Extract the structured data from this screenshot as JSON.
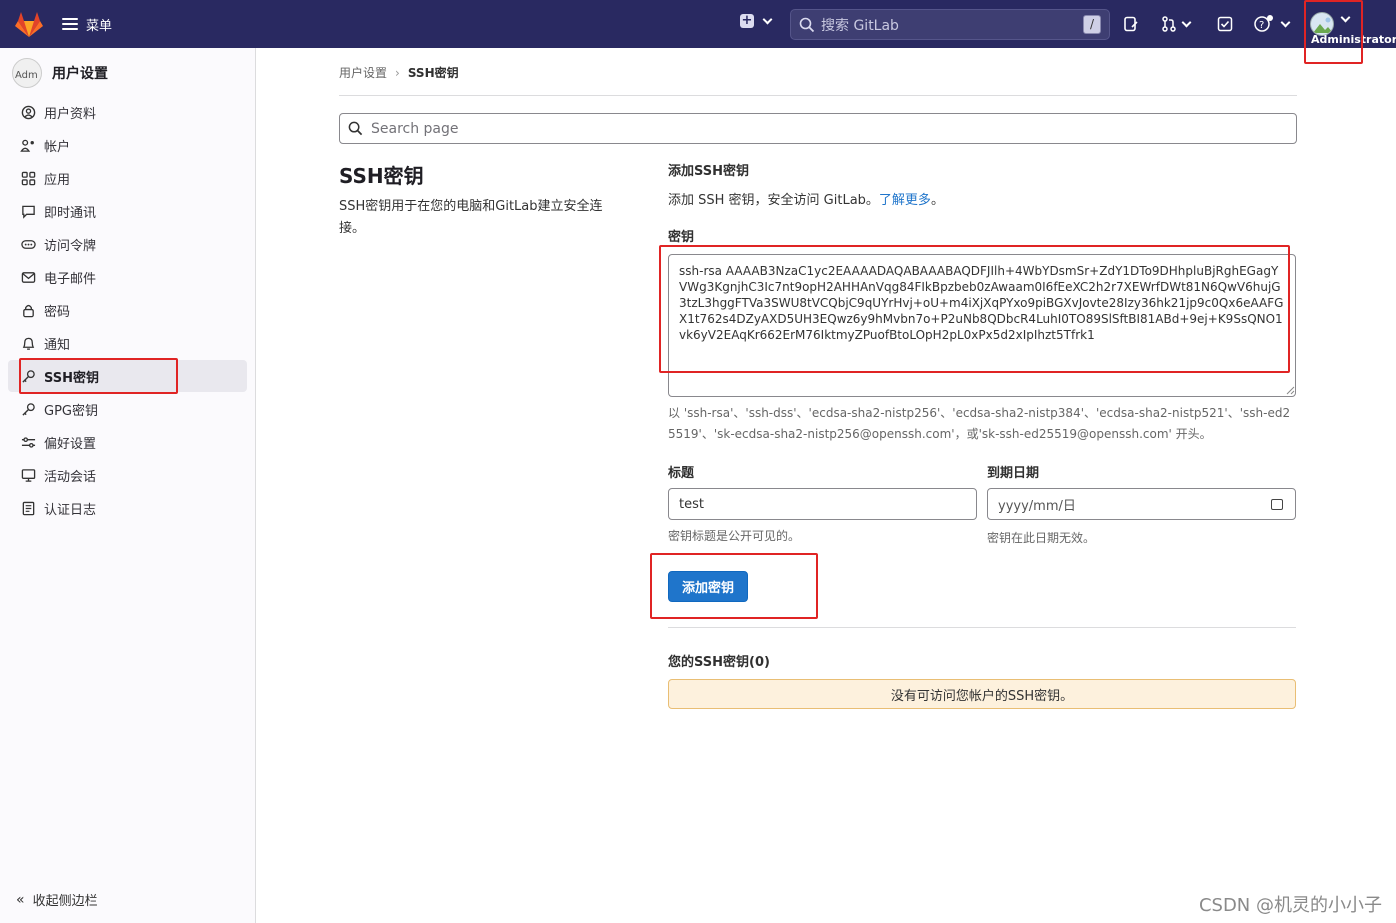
{
  "topbar": {
    "menu_label": "菜单",
    "search_placeholder": "搜索 GitLab",
    "search_shortcut": "/",
    "user_name": "Administrator"
  },
  "sidebar": {
    "title": "用户设置",
    "avatar_alt": "Adm",
    "items": [
      {
        "label": "用户资料",
        "icon": "profile-icon"
      },
      {
        "label": "帐户",
        "icon": "account-icon"
      },
      {
        "label": "应用",
        "icon": "applications-icon"
      },
      {
        "label": "即时通讯",
        "icon": "chat-icon"
      },
      {
        "label": "访问令牌",
        "icon": "token-icon"
      },
      {
        "label": "电子邮件",
        "icon": "mail-icon"
      },
      {
        "label": "密码",
        "icon": "lock-icon"
      },
      {
        "label": "通知",
        "icon": "bell-icon"
      },
      {
        "label": "SSH密钥",
        "icon": "key-icon"
      },
      {
        "label": "GPG密钥",
        "icon": "key-icon"
      },
      {
        "label": "偏好设置",
        "icon": "preferences-icon"
      },
      {
        "label": "活动会话",
        "icon": "sessions-icon"
      },
      {
        "label": "认证日志",
        "icon": "log-icon"
      }
    ],
    "active_index": 8,
    "collapse_label": "收起侧边栏"
  },
  "breadcrumb": {
    "parent": "用户设置",
    "current": "SSH密钥"
  },
  "search_page_placeholder": "Search page",
  "section": {
    "title": "SSH密钥",
    "description": "SSH密钥用于在您的电脑和GitLab建立安全连接。"
  },
  "form": {
    "heading": "添加SSH密钥",
    "intro": "添加 SSH 密钥，安全访问 GitLab。",
    "learn_more": "了解更多",
    "intro_end": "。",
    "key_label": "密钥",
    "key_value": "ssh-rsa AAAAB3NzaC1yc2EAAAADAQABAAABAQDFJIlh+4WbYDsmSr+ZdY1DTo9DHhpluBjRghEGagYVWg3KgnjhC3Ic7nt9opH2AHHAnVqg84FIkBpzbeb0zAwaam0I6fEeXC2h2r7XEWrfDWt81N6QwV6hujG3tzL3hggFTVa3SWU8tVCQbjC9qUYrHvj+oU+m4iXjXqPYxo9piBGXvJovte28Izy36hk21jp9c0Qx6eAAFGX1t762s4DZyAXD5UH3EQwz6y9hMvbn7o+P2uNb8QDbcR4LuhI0TO89SlSftBI81ABd+9ej+K9SsQNO1vk6yV2EAqKr662ErM76IktmyZPuofBtoLOpH2pL0xPx5d2xIpIhzt5Tfrk1",
    "key_help": "以 'ssh-rsa'、'ssh-dss'、'ecdsa-sha2-nistp256'、'ecdsa-sha2-nistp384'、'ecdsa-sha2-nistp521'、'ssh-ed25519'、'sk-ecdsa-sha2-nistp256@openssh.com'，或'sk-ssh-ed25519@openssh.com' 开头。",
    "title_label": "标题",
    "title_value": "test",
    "title_help": "密钥标题是公开可见的。",
    "expiry_label": "到期日期",
    "expiry_placeholder": "yyyy/mm/日",
    "expiry_help": "密钥在此日期无效。",
    "submit_label": "添加密钥"
  },
  "keys_list": {
    "heading": "您的SSH密钥(0)",
    "empty_message": "没有可访问您帐户的SSH密钥。"
  },
  "watermark": "CSDN @机灵的小小子",
  "colors": {
    "topbar": "#292961",
    "primary": "#1f75cb",
    "highlight": "#e02424",
    "alert_bg": "#fdf1dd"
  }
}
